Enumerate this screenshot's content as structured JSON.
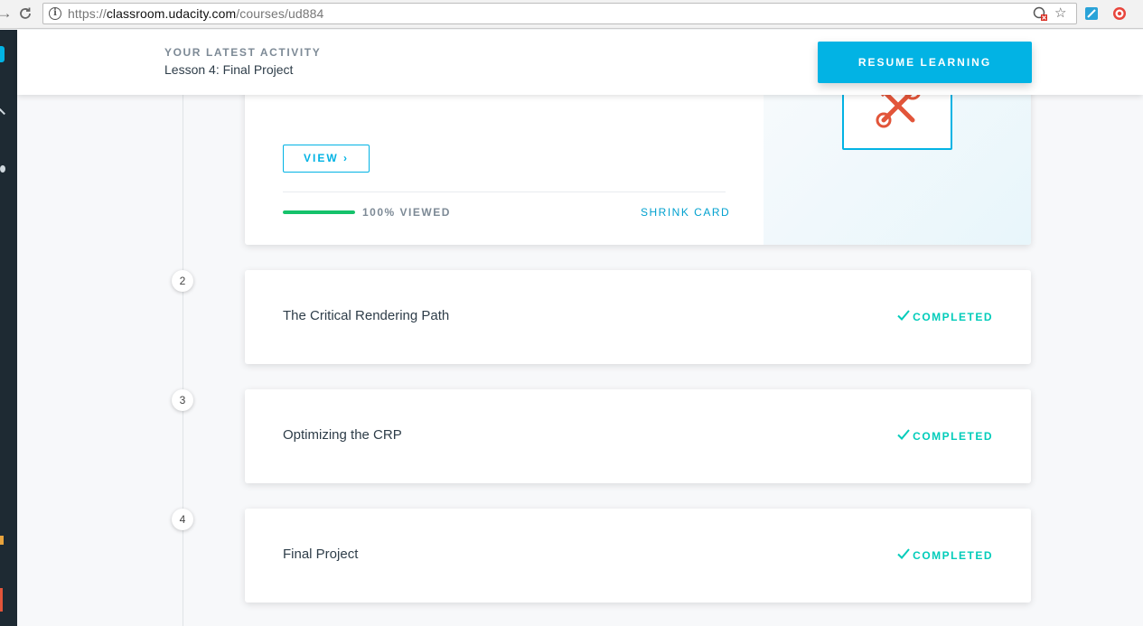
{
  "browser": {
    "url_scheme": "https://",
    "url_host": "classroom.udacity.com",
    "url_path": "/courses/ud884"
  },
  "header": {
    "latest_label": "YOUR LATEST ACTIVITY",
    "latest_lesson": "Lesson 4: Final Project",
    "resume_label": "RESUME LEARNING"
  },
  "expanded_card": {
    "view_label": "VIEW",
    "view_chevron": "›",
    "progress_percent": 100,
    "progress_text": "100% VIEWED",
    "shrink_label": "SHRINK CARD",
    "image_icon": "tools-icon"
  },
  "lessons": [
    {
      "number": "2",
      "title": "The Critical Rendering Path",
      "status": "COMPLETED"
    },
    {
      "number": "3",
      "title": "Optimizing the CRP",
      "status": "COMPLETED"
    },
    {
      "number": "4",
      "title": "Final Project",
      "status": "COMPLETED"
    }
  ],
  "colors": {
    "accent": "#02b3e4",
    "completed": "#02ccba",
    "progress": "#15c26b",
    "tools_icon": "#e2553a"
  }
}
